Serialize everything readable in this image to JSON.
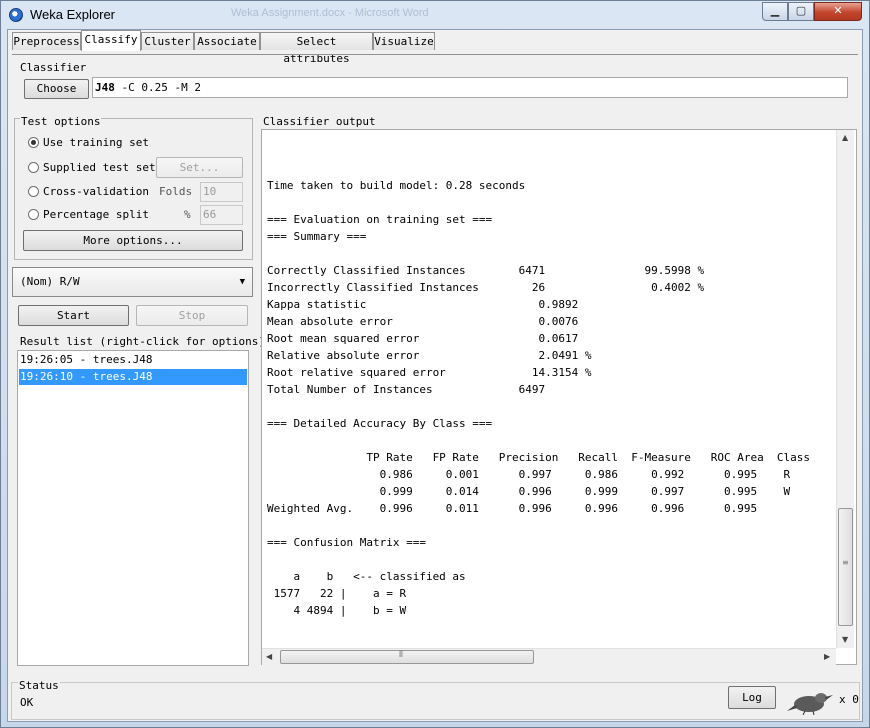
{
  "window": {
    "title": "Weka Explorer",
    "background_title": "Weka Assignment.docx - Microsoft Word",
    "buttons": {
      "minimize": "▁",
      "maximize": "▢",
      "close": "✕"
    }
  },
  "tabs": [
    {
      "label": "Preprocess",
      "active": false
    },
    {
      "label": "Classify",
      "active": true
    },
    {
      "label": "Cluster",
      "active": false
    },
    {
      "label": "Associate",
      "active": false
    },
    {
      "label": "Select attributes",
      "active": false
    },
    {
      "label": "Visualize",
      "active": false
    }
  ],
  "classifier": {
    "group_label": "Classifier",
    "choose_label": "Choose",
    "name": "J48",
    "options": " -C 0.25 -M 2"
  },
  "test_options": {
    "group_label": "Test options",
    "use_training_set": "Use training set",
    "supplied_test_set": "Supplied test set",
    "set_button": "Set...",
    "cross_validation": "Cross-validation",
    "folds_label": "Folds",
    "folds_value": "10",
    "percentage_split": "Percentage split",
    "percent_label": "%",
    "percent_value": "66",
    "more_options": "More options...",
    "selected": "use_training_set"
  },
  "class_attribute": {
    "value": "(Nom) R/W"
  },
  "actions": {
    "start": "Start",
    "stop": "Stop"
  },
  "result_list": {
    "label": "Result list (right-click for options)",
    "items": [
      {
        "label": "19:26:05 - trees.J48",
        "selected": false
      },
      {
        "label": "19:26:10 - trees.J48",
        "selected": true
      }
    ]
  },
  "output": {
    "label": "Classifier output",
    "lines": [
      "",
      "",
      "Time taken to build model: 0.28 seconds",
      "",
      "=== Evaluation on training set ===",
      "=== Summary ===",
      "",
      "Correctly Classified Instances        6471               99.5998 %",
      "Incorrectly Classified Instances        26                0.4002 %",
      "Kappa statistic                          0.9892",
      "Mean absolute error                      0.0076",
      "Root mean squared error                  0.0617",
      "Relative absolute error                  2.0491 %",
      "Root relative squared error             14.3154 %",
      "Total Number of Instances             6497",
      "",
      "=== Detailed Accuracy By Class ===",
      "",
      "               TP Rate   FP Rate   Precision   Recall  F-Measure   ROC Area  Class",
      "                 0.986     0.001      0.997     0.986     0.992      0.995    R",
      "                 0.999     0.014      0.996     0.999     0.997      0.995    W",
      "Weighted Avg.    0.996     0.011      0.996     0.996     0.996      0.995",
      "",
      "=== Confusion Matrix ===",
      "",
      "    a    b   <-- classified as",
      " 1577   22 |    a = R",
      "    4 4894 |    b = W"
    ]
  },
  "status": {
    "label": "Status",
    "text": "OK",
    "log_button": "Log",
    "count": "x 0"
  }
}
